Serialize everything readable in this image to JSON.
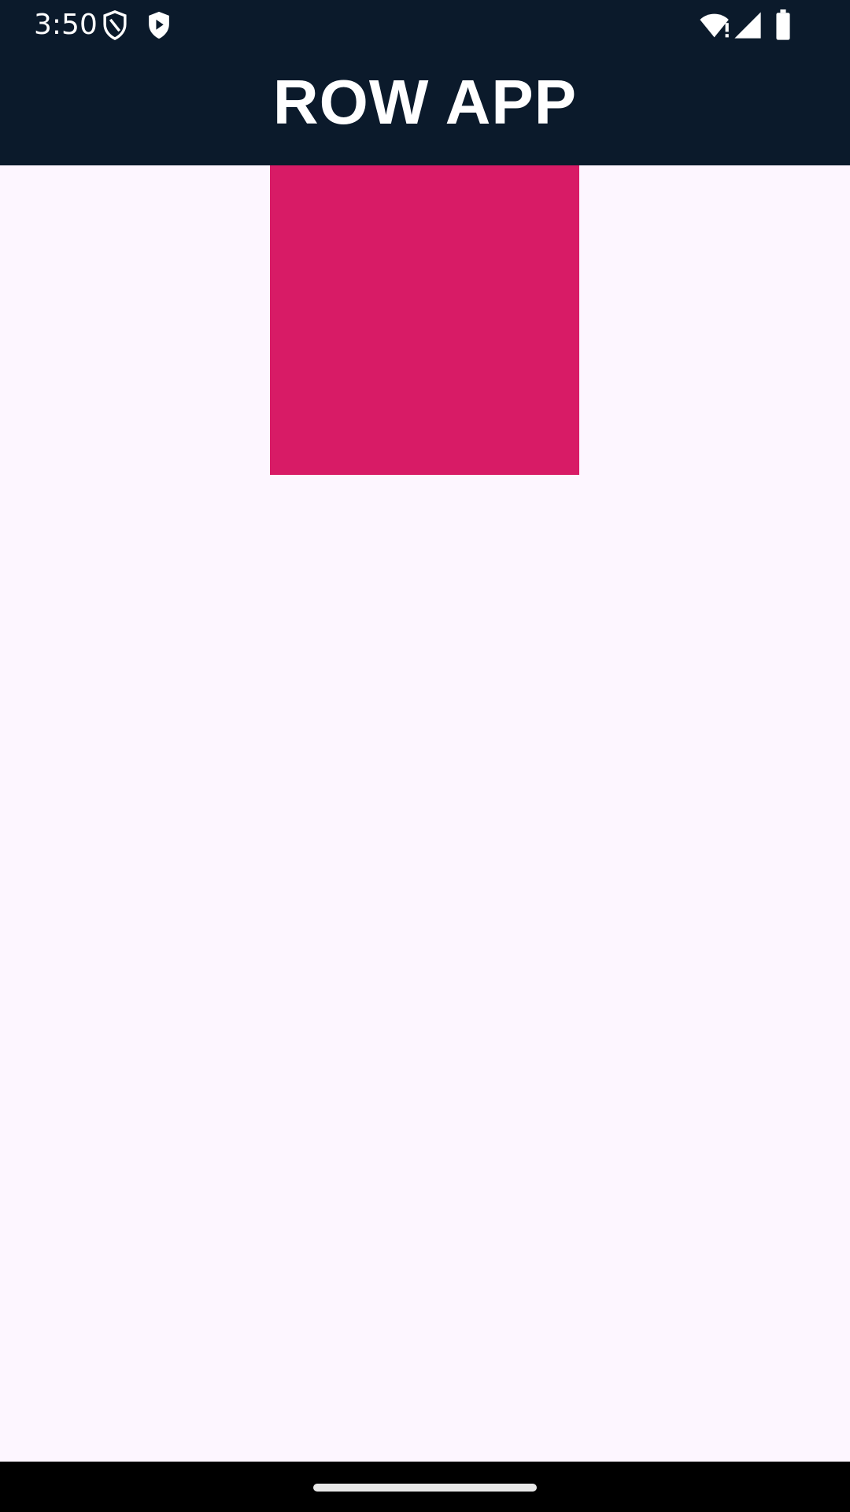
{
  "status_bar": {
    "time": "3:50",
    "left_icons": [
      "shield-outline-icon",
      "shield-play-icon"
    ],
    "right_icons": [
      "wifi-alert-icon",
      "cell-signal-icon",
      "battery-icon"
    ]
  },
  "app_bar": {
    "title": "ROW APP"
  },
  "content": {
    "box_color": "#d81b66"
  },
  "colors": {
    "bar_background": "#0b1a2b",
    "page_background": "#fdf6ff"
  }
}
